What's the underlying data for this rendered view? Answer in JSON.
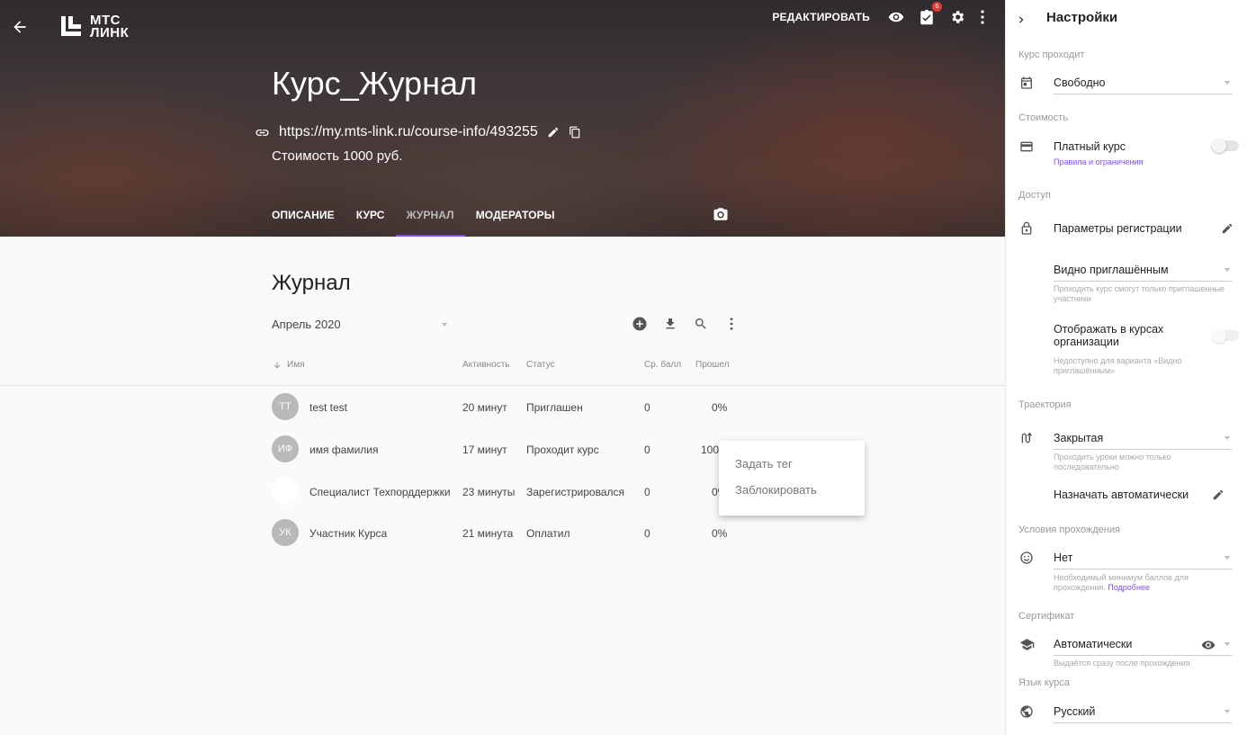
{
  "header": {
    "edit_label": "РЕДАКТИРОВАТЬ",
    "badge_count": "6",
    "logo_line1": "МТС",
    "logo_line2": "ЛИНК"
  },
  "course": {
    "title": "Курс_Журнал",
    "url": "https://my.mts-link.ru/course-info/493255",
    "price": "Стоимость 1000 руб."
  },
  "tabs": [
    {
      "label": "ОПИСАНИЕ",
      "active": false
    },
    {
      "label": "КУРС",
      "active": false
    },
    {
      "label": "ЖУРНАЛ",
      "active": true
    },
    {
      "label": "МОДЕРАТОРЫ",
      "active": false
    }
  ],
  "journal": {
    "title": "Журнал",
    "month": "Апрель 2020",
    "columns": {
      "name": "Имя",
      "activity": "Активность",
      "status": "Статус",
      "avg": "Ср. балл",
      "passed": "Прошел"
    },
    "rows": [
      {
        "initials": "ТТ",
        "name": "test test",
        "activity": "20 минут",
        "status": "Приглашен",
        "avg": "0",
        "passed": "0%"
      },
      {
        "initials": "ИФ",
        "name": "имя фамилия",
        "activity": "17 минут",
        "status": "Проходит курс",
        "avg": "0",
        "passed": "100%"
      },
      {
        "initials": "",
        "name": "Специалист Техпорддержки",
        "activity": "23 минуты",
        "status": "Зарегистрировался",
        "avg": "0",
        "passed": "0%"
      },
      {
        "initials": "УК",
        "name": "Участник Курса",
        "activity": "21 минута",
        "status": "Оплатил",
        "avg": "0",
        "passed": "0%"
      }
    ]
  },
  "context_menu": {
    "items": [
      "Задать тег",
      "Заблокировать"
    ]
  },
  "settings": {
    "title": "Настройки",
    "pass_group": "Курс проходит",
    "pass_value": "Свободно",
    "cost_group": "Стоимость",
    "paid_label": "Платный курс",
    "paid_link": "Правила и ограничения",
    "access_group": "Доступ",
    "registration_label": "Параметры регистрации",
    "visibility_value": "Видно приглашённым",
    "visibility_hint": "Проходить курс смогут только приглашенные участники",
    "show_in_org_label": "Отображать в курсах организации",
    "show_in_org_hint": "Недоступно для варианта «Видно приглашённым»",
    "trajectory_group": "Траектория",
    "trajectory_value": "Закрытая",
    "trajectory_hint": "Проходить уроки можно только последовательно",
    "auto_assign_label": "Назначать автоматически",
    "conditions_group": "Условия прохождения",
    "conditions_value": "Нет",
    "conditions_hint": "Необходимый минимум баллов для прохождения.",
    "conditions_link": "Подробнее",
    "certificate_group": "Сертификат",
    "certificate_value": "Автоматически",
    "certificate_hint": "Выдаётся сразу после прохождения",
    "language_group": "Язык курса",
    "language_value": "Русский"
  },
  "colors": {
    "accent": "#7c4dff",
    "badge": "#e53935"
  },
  "icons": [
    "arrow-left-icon",
    "eye-icon",
    "clipboard-check-icon",
    "gear-icon",
    "more-vert-icon",
    "link-icon",
    "pencil-icon",
    "copy-icon",
    "camera-icon",
    "add-circle-icon",
    "download-icon",
    "search-icon",
    "sort-down-icon",
    "chevron-right-icon",
    "calendar-icon",
    "credit-card-icon",
    "lock-icon",
    "route-icon",
    "smile-icon",
    "graduation-cap-icon",
    "globe-icon"
  ]
}
